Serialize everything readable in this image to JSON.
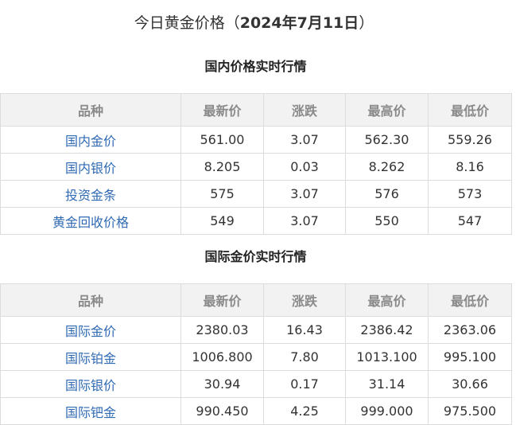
{
  "title": {
    "prefix": "今日黄金价格（",
    "date": "2024年7月11日",
    "suffix": "）"
  },
  "columns": [
    "品种",
    "最新价",
    "涨跌",
    "最高价",
    "最低价"
  ],
  "domestic": {
    "heading": "国内价格实时行情",
    "rows": [
      {
        "name": "国内金价",
        "latest": "561.00",
        "change": "3.07",
        "high": "562.30",
        "low": "559.26"
      },
      {
        "name": "国内银价",
        "latest": "8.205",
        "change": "0.03",
        "high": "8.262",
        "low": "8.16"
      },
      {
        "name": "投资金条",
        "latest": "575",
        "change": "3.07",
        "high": "576",
        "low": "573"
      },
      {
        "name": "黄金回收价格",
        "latest": "549",
        "change": "3.07",
        "high": "550",
        "low": "547"
      }
    ]
  },
  "international": {
    "heading": "国际金价实时行情",
    "rows": [
      {
        "name": "国际金价",
        "latest": "2380.03",
        "change": "16.43",
        "high": "2386.42",
        "low": "2363.06"
      },
      {
        "name": "国际铂金",
        "latest": "1006.800",
        "change": "7.80",
        "high": "1013.100",
        "low": "995.100"
      },
      {
        "name": "国际银价",
        "latest": "30.94",
        "change": "0.17",
        "high": "31.14",
        "low": "30.66"
      },
      {
        "name": "国际钯金",
        "latest": "990.450",
        "change": "4.25",
        "high": "999.000",
        "low": "975.500"
      }
    ]
  }
}
